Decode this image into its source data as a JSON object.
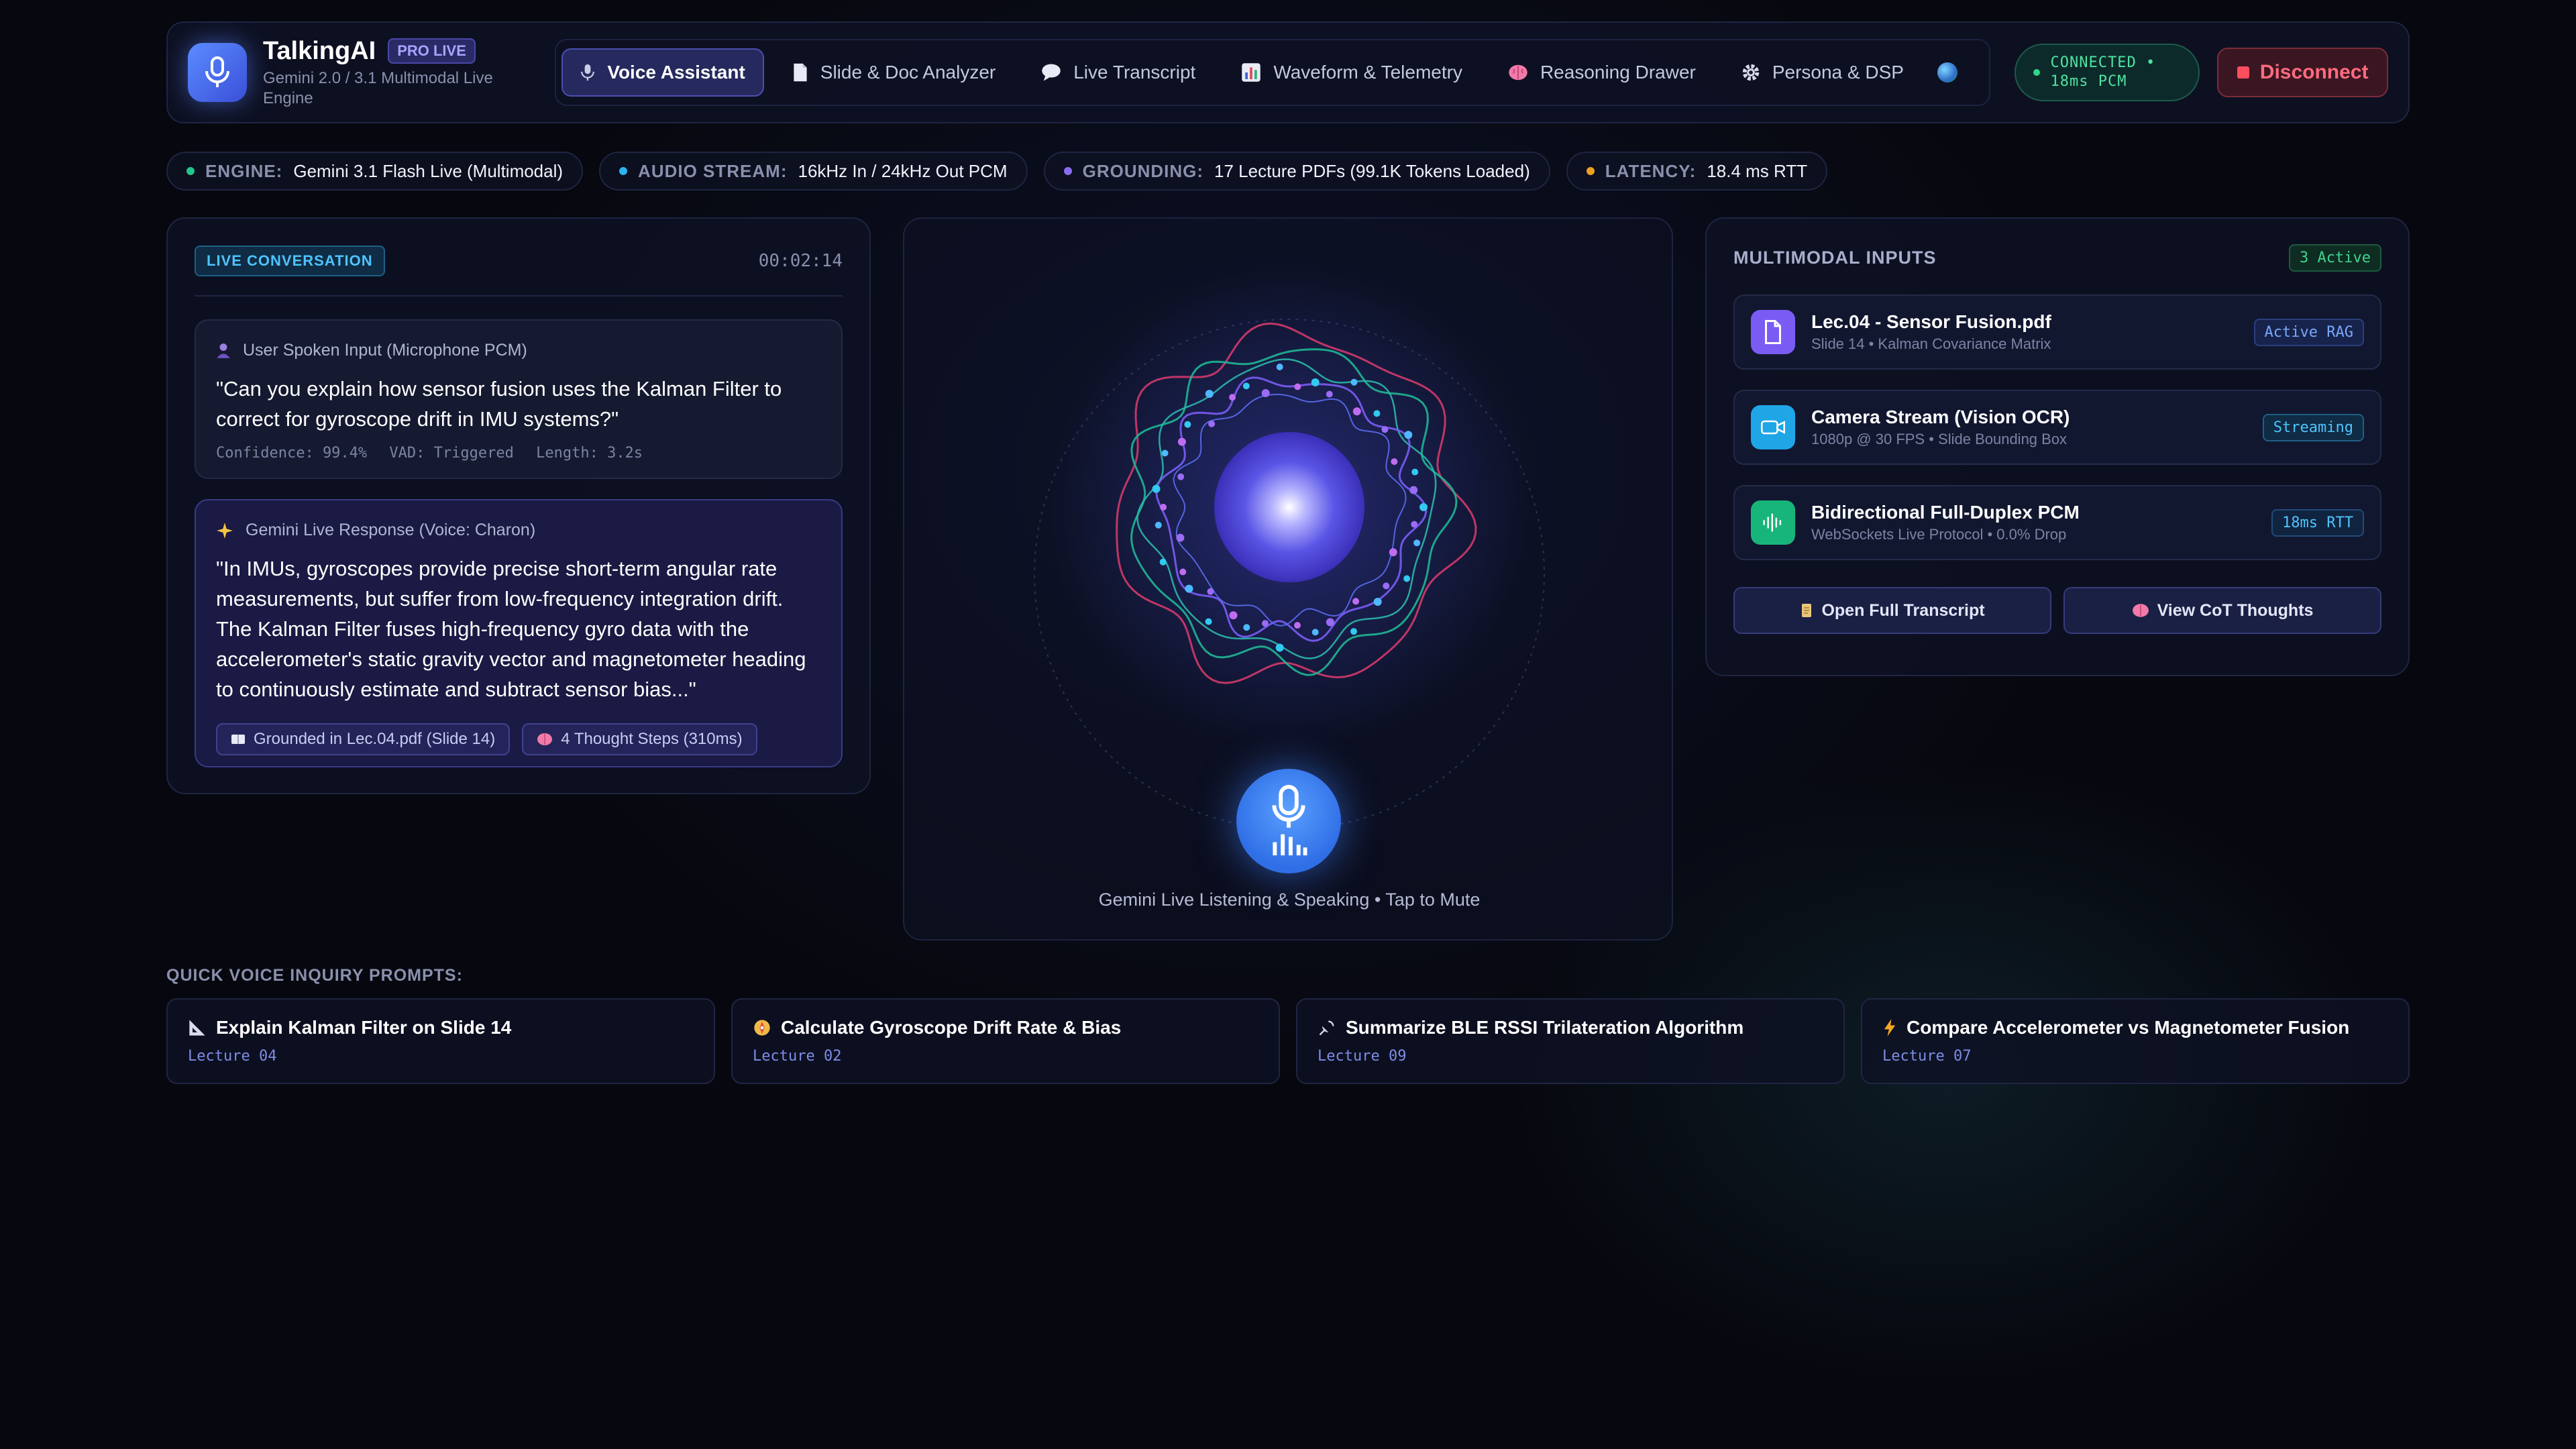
{
  "brand": {
    "name": "TalkingAI",
    "badge": "PRO LIVE",
    "subtitle": "Gemini 2.0 / 3.1 Multimodal Live Engine"
  },
  "nav": {
    "tabs": [
      {
        "label": "Voice Assistant",
        "icon": "mic-icon",
        "active": true
      },
      {
        "label": "Slide & Doc Analyzer",
        "icon": "document-icon"
      },
      {
        "label": "Live Transcript",
        "icon": "speech-bubble-icon"
      },
      {
        "label": "Waveform & Telemetry",
        "icon": "bar-chart-icon"
      },
      {
        "label": "Reasoning Drawer",
        "icon": "brain-icon"
      },
      {
        "label": "Persona & DSP",
        "icon": "gear-icon"
      }
    ]
  },
  "connection": {
    "line1": "CONNECTED •",
    "line2": "18ms PCM"
  },
  "disconnect_label": "Disconnect",
  "status": [
    {
      "label": "ENGINE:",
      "value": "Gemini 3.1 Flash Live (Multimodal)",
      "color": "#22c58a"
    },
    {
      "label": "AUDIO STREAM:",
      "value": "16kHz In / 24kHz Out PCM",
      "color": "#2ab4f0"
    },
    {
      "label": "GROUNDING:",
      "value": "17 Lecture PDFs (99.1K Tokens Loaded)",
      "color": "#8a6cf0"
    },
    {
      "label": "LATENCY:",
      "value": "18.4 ms RTT",
      "color": "#f0a020"
    }
  ],
  "conversation": {
    "badge": "LIVE CONVERSATION",
    "timer": "00:02:14",
    "user": {
      "title": "User Spoken Input (Microphone PCM)",
      "text": "\"Can you explain how sensor fusion uses the Kalman Filter to correct for gyroscope drift in IMU systems?\"",
      "meta": [
        "Confidence: 99.4%",
        "VAD: Triggered",
        "Length: 3.2s"
      ]
    },
    "ai": {
      "title": "Gemini Live Response (Voice: Charon)",
      "text": "\"In IMUs, gyroscopes provide precise short-term angular rate measurements, but suffer from low-frequency integration drift. The Kalman Filter fuses high-frequency gyro data with the accelerometer's static gravity vector and magnetometer heading to continuously estimate and subtract sensor bias...\"",
      "chips": [
        {
          "label": "Grounded in Lec.04.pdf (Slide 14)",
          "icon": "book-icon"
        },
        {
          "label": "4 Thought Steps (310ms)",
          "icon": "brain-icon"
        }
      ]
    }
  },
  "center": {
    "caption": "Gemini Live Listening & Speaking • Tap to Mute"
  },
  "inputs": {
    "title": "MULTIMODAL INPUTS",
    "active_count": "3 Active",
    "items": [
      {
        "name": "Lec.04 - Sensor Fusion.pdf",
        "sub": "Slide 14 • Kalman Covariance Matrix",
        "tag": "Active RAG",
        "icon": "file-icon",
        "color": "#7a5cf5"
      },
      {
        "name": "Camera Stream (Vision OCR)",
        "sub": "1080p @ 30 FPS • Slide Bounding Box",
        "tag": "Streaming",
        "icon": "video-camera-icon",
        "color": "#1fa6e6"
      },
      {
        "name": "Bidirectional Full-Duplex PCM",
        "sub": "WebSockets Live Protocol • 0.0% Drop",
        "tag": "18ms RTT",
        "icon": "audio-wave-icon",
        "color": "#18b57a"
      }
    ],
    "buttons": [
      {
        "label": "Open Full Transcript",
        "icon": "scroll-icon"
      },
      {
        "label": "View CoT Thoughts",
        "icon": "brain-icon"
      }
    ]
  },
  "quick_prompts": {
    "label": "QUICK VOICE INQUIRY PROMPTS:",
    "items": [
      {
        "title": "Explain Kalman Filter on Slide 14",
        "sub": "Lecture 04",
        "icon": "triangle-ruler-icon"
      },
      {
        "title": "Calculate Gyroscope Drift Rate & Bias",
        "sub": "Lecture 02",
        "icon": "compass-icon"
      },
      {
        "title": "Summarize BLE RSSI Trilateration Algorithm",
        "sub": "Lecture 09",
        "icon": "satellite-icon"
      },
      {
        "title": "Compare Accelerometer vs Magnetometer Fusion",
        "sub": "Lecture 07",
        "icon": "lightning-icon"
      }
    ]
  }
}
